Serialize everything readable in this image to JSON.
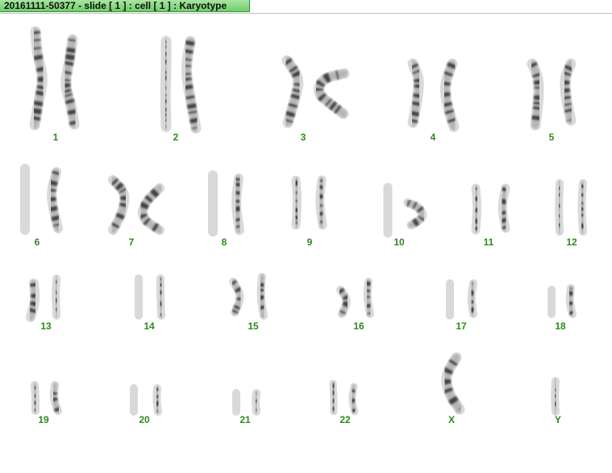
{
  "window": {
    "title": "20161111-50377 - slide [ 1 ] : cell [ 1 ] : Karyotype"
  },
  "colors": {
    "label": "#2d8a1e",
    "title_tab": "#7fd47a",
    "chromosome_dark": "#1e1e1e",
    "chromosome_light": "#d9d9d9"
  },
  "karyotype": {
    "labels": [
      "1",
      "2",
      "3",
      "4",
      "5",
      "6",
      "7",
      "8",
      "9",
      "10",
      "11",
      "12",
      "13",
      "14",
      "15",
      "16",
      "17",
      "18",
      "19",
      "20",
      "21",
      "22",
      "X",
      "Y"
    ]
  }
}
